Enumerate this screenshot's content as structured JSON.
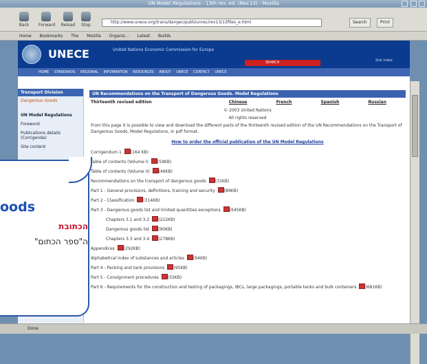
{
  "window": {
    "title": "UN Model Regulations - 13th rev. ed. (Rev.13) - Mozilla"
  },
  "toolbar": {
    "back": "Back",
    "forward": "Forward",
    "reload": "Reload",
    "stop": "Stop",
    "url": "http://www.unece.org/trans/danger/publi/unrec/rev13/13files_e.html",
    "search_label": "Search",
    "print_label": "Print"
  },
  "bookmarks": [
    "Home",
    "Bookmarks",
    "The Mozilla Organiz...",
    "Latest Builds"
  ],
  "site": {
    "name": "UNECE",
    "subtitle": "United Nations Economic Commission for Europe",
    "search_label": "SEARCH",
    "right_link": "Site index",
    "nav": [
      "HOME",
      "STANDARDS",
      "REGIONAL",
      "INFORMATION RESOURCES",
      "ABOUT UNECE",
      "CONTACT UNECE"
    ]
  },
  "sidebar": {
    "header": "Transport Division",
    "items": [
      "Dangerous Goods",
      "UN Model Regulations",
      "Foreword",
      "Publications details (Corrigenda)",
      "Site content"
    ]
  },
  "main": {
    "header": "UN Recommendations on the Transport of Dangerous Goods. Model Regulations",
    "edition": "Thirteenth revised edition",
    "languages": [
      "Chinese",
      "French",
      "Spanish",
      "Russian"
    ],
    "copyright1": "© 2003 United Nations",
    "copyright2": "All rights reserved",
    "intro": "From this page it is possible to view and download the different parts of the thirteenth revised edition of the UN Recommendations on the Transport of Dangerous Goods, Model Regulations, in pdf format.",
    "order_link": "How to order the official publication of the UN Model Regulations",
    "items": [
      {
        "label": "Corrigendum 1",
        "size": "(164 KB)",
        "indent": false
      },
      {
        "label": "Table of contents (Volume I)",
        "size": "(59KB)",
        "indent": false
      },
      {
        "label": "Table of contents (Volume II)",
        "size": "(46KB)",
        "indent": false
      },
      {
        "label": "Recommendations on the transport of dangerous goods",
        "size": "(31KB)",
        "indent": false
      },
      {
        "label": "Part 1 - General provisions, definitions, training and security",
        "size": "(89KB)",
        "indent": false
      },
      {
        "label": "Part 2 - Classification",
        "size": "(314KB)",
        "indent": false
      },
      {
        "label": "Part 3 - Dangerous goods list and limited quantities exceptions",
        "size": "(645KB)",
        "indent": false
      },
      {
        "label": "Chapters 3.1 and 3.2",
        "size": "(222KB)",
        "indent": true
      },
      {
        "label": "Dangerous goods list",
        "size": "(90KB)",
        "indent": true
      },
      {
        "label": "Chapters 3.3 and 3.4",
        "size": "(278KB)",
        "indent": true
      },
      {
        "label": "Appendices",
        "size": "(292KB)",
        "indent": false
      },
      {
        "label": "Alphabetical index of substances and articles",
        "size": "(94KB)",
        "indent": false
      },
      {
        "label": "Part 4 - Packing and tank provisions",
        "size": "(95KB)",
        "indent": false
      },
      {
        "label": "Part 5 - Consignment procedures",
        "size": "(55KB)",
        "indent": false
      },
      {
        "label": "Part 6 - Requirements for the construction and testing of packagings, IBCs, large packagings, portable tanks and bulk containers",
        "size": "(681KB)",
        "indent": false
      }
    ]
  },
  "status": {
    "text": "Done"
  },
  "callout": {
    "title": "oods",
    "hebrew1": "הכתובת",
    "hebrew2": "ה\"ספר הכתום\""
  }
}
